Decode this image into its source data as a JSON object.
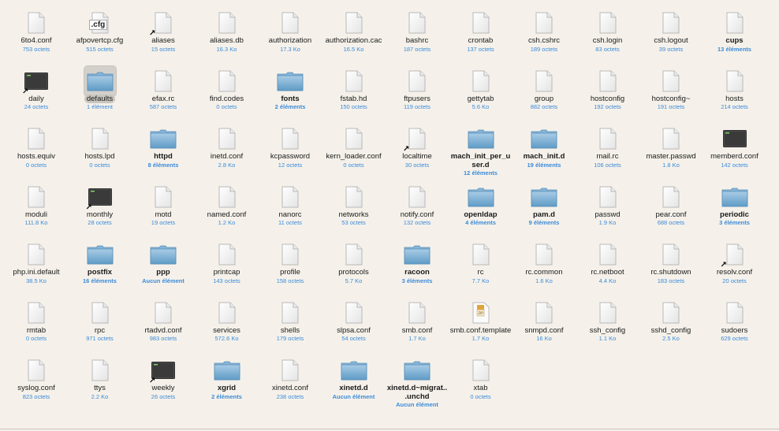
{
  "window": {
    "view": "icon-grid"
  },
  "colors": {
    "background": "#f5f1ea",
    "size_text": "#3c8bd8",
    "folder": "#6fa7cf"
  },
  "items": [
    {
      "name": "6to4.conf",
      "size": "753 octets",
      "type": "doc"
    },
    {
      "name": "afpovertcp.cfg",
      "size": "515 octets",
      "type": "cfg",
      "badge": ".cfg"
    },
    {
      "name": "aliases",
      "size": "15 octets",
      "type": "doc",
      "alias": true
    },
    {
      "name": "aliases.db",
      "size": "16.3 Ko",
      "type": "doc"
    },
    {
      "name": "authorization",
      "size": "17.3 Ko",
      "type": "doc"
    },
    {
      "name": "authorization.cac",
      "size": "16.5 Ko",
      "type": "doc"
    },
    {
      "name": "bashrc",
      "size": "187 octets",
      "type": "doc"
    },
    {
      "name": "crontab",
      "size": "137 octets",
      "type": "doc"
    },
    {
      "name": "csh.cshrc",
      "size": "189 octets",
      "type": "doc"
    },
    {
      "name": "csh.login",
      "size": "83 octets",
      "type": "doc"
    },
    {
      "name": "csh.logout",
      "size": "39 octets",
      "type": "doc"
    },
    {
      "name": "cups",
      "size": "13 éléments",
      "type": "doc",
      "bold": true
    },
    {
      "name": "daily",
      "size": "24 octets",
      "type": "terminal",
      "alias": true
    },
    {
      "name": "defaults",
      "size": "1 élément",
      "type": "folder",
      "selected": true
    },
    {
      "name": "efax.rc",
      "size": "587 octets",
      "type": "doc"
    },
    {
      "name": "find.codes",
      "size": "0 octets",
      "type": "doc"
    },
    {
      "name": "fonts",
      "size": "2 éléments",
      "type": "folder",
      "bold": true
    },
    {
      "name": "fstab.hd",
      "size": "150 octets",
      "type": "doc"
    },
    {
      "name": "ftpusers",
      "size": "119 octets",
      "type": "doc"
    },
    {
      "name": "gettytab",
      "size": "5.6 Ko",
      "type": "doc"
    },
    {
      "name": "group",
      "size": "882 octets",
      "type": "doc"
    },
    {
      "name": "hostconfig",
      "size": "192 octets",
      "type": "doc"
    },
    {
      "name": "hostconfig~",
      "size": "191 octets",
      "type": "doc"
    },
    {
      "name": "hosts",
      "size": "214 octets",
      "type": "doc"
    },
    {
      "name": "hosts.equiv",
      "size": "0 octets",
      "type": "doc"
    },
    {
      "name": "hosts.lpd",
      "size": "0 octets",
      "type": "doc"
    },
    {
      "name": "httpd",
      "size": "8 éléments",
      "type": "folder",
      "bold": true
    },
    {
      "name": "inetd.conf",
      "size": "2.8 Ko",
      "type": "doc"
    },
    {
      "name": "kcpassword",
      "size": "12 octets",
      "type": "doc"
    },
    {
      "name": "kern_loader.conf",
      "size": "0 octets",
      "type": "doc"
    },
    {
      "name": "localtime",
      "size": "30 octets",
      "type": "doc",
      "alias": true
    },
    {
      "name": "mach_init_per_user.d",
      "size": "12 éléments",
      "type": "folder",
      "bold": true
    },
    {
      "name": "mach_init.d",
      "size": "19 éléments",
      "type": "folder",
      "bold": true
    },
    {
      "name": "mail.rc",
      "size": "106 octets",
      "type": "doc"
    },
    {
      "name": "master.passwd",
      "size": "1.8 Ko",
      "type": "doc"
    },
    {
      "name": "memberd.conf",
      "size": "142 octets",
      "type": "terminal"
    },
    {
      "name": "moduli",
      "size": "111.8 Ko",
      "type": "doc"
    },
    {
      "name": "monthly",
      "size": "28 octets",
      "type": "terminal",
      "alias": true
    },
    {
      "name": "motd",
      "size": "19 octets",
      "type": "doc"
    },
    {
      "name": "named.conf",
      "size": "1.2 Ko",
      "type": "doc"
    },
    {
      "name": "nanorc",
      "size": "11 octets",
      "type": "doc"
    },
    {
      "name": "networks",
      "size": "53 octets",
      "type": "doc"
    },
    {
      "name": "notify.conf",
      "size": "132 octets",
      "type": "doc"
    },
    {
      "name": "openldap",
      "size": "4 éléments",
      "type": "folder",
      "bold": true
    },
    {
      "name": "pam.d",
      "size": "9 éléments",
      "type": "folder",
      "bold": true
    },
    {
      "name": "passwd",
      "size": "1.9 Ko",
      "type": "doc"
    },
    {
      "name": "pear.conf",
      "size": "688 octets",
      "type": "doc"
    },
    {
      "name": "periodic",
      "size": "3 éléments",
      "type": "folder",
      "bold": true
    },
    {
      "name": "php.ini.default",
      "size": "38.5 Ko",
      "type": "doc"
    },
    {
      "name": "postfix",
      "size": "16 éléments",
      "type": "folder",
      "bold": true
    },
    {
      "name": "ppp",
      "size": "Aucun élément",
      "type": "folder",
      "bold": true
    },
    {
      "name": "printcap",
      "size": "143 octets",
      "type": "doc"
    },
    {
      "name": "profile",
      "size": "158 octets",
      "type": "doc"
    },
    {
      "name": "protocols",
      "size": "5.7 Ko",
      "type": "doc"
    },
    {
      "name": "racoon",
      "size": "3 éléments",
      "type": "folder",
      "bold": true
    },
    {
      "name": "rc",
      "size": "7.7 Ko",
      "type": "doc"
    },
    {
      "name": "rc.common",
      "size": "1.6 Ko",
      "type": "doc"
    },
    {
      "name": "rc.netboot",
      "size": "4.4 Ko",
      "type": "doc"
    },
    {
      "name": "rc.shutdown",
      "size": "183 octets",
      "type": "doc"
    },
    {
      "name": "resolv.conf",
      "size": "20 octets",
      "type": "doc",
      "alias": true
    },
    {
      "name": "rmtab",
      "size": "0 octets",
      "type": "doc"
    },
    {
      "name": "rpc",
      "size": "971 octets",
      "type": "doc"
    },
    {
      "name": "rtadvd.conf",
      "size": "983 octets",
      "type": "doc"
    },
    {
      "name": "services",
      "size": "572.6 Ko",
      "type": "doc"
    },
    {
      "name": "shells",
      "size": "179 octets",
      "type": "doc"
    },
    {
      "name": "slpsa.conf",
      "size": "54 octets",
      "type": "doc"
    },
    {
      "name": "smb.conf",
      "size": "1.7 Ko",
      "type": "doc"
    },
    {
      "name": "smb.conf.template",
      "size": "1.7 Ko",
      "type": "zip"
    },
    {
      "name": "snmpd.conf",
      "size": "16 Ko",
      "type": "doc"
    },
    {
      "name": "ssh_config",
      "size": "1.1 Ko",
      "type": "doc"
    },
    {
      "name": "sshd_config",
      "size": "2.5 Ko",
      "type": "doc"
    },
    {
      "name": "sudoers",
      "size": "629 octets",
      "type": "doc"
    },
    {
      "name": "syslog.conf",
      "size": "823 octets",
      "type": "doc"
    },
    {
      "name": "ttys",
      "size": "2.2 Ko",
      "type": "doc"
    },
    {
      "name": "weekly",
      "size": "26 octets",
      "type": "terminal",
      "alias": true
    },
    {
      "name": "xgrid",
      "size": "2 éléments",
      "type": "folder",
      "bold": true
    },
    {
      "name": "xinetd.conf",
      "size": "238 octets",
      "type": "doc"
    },
    {
      "name": "xinetd.d",
      "size": "Aucun élément",
      "type": "folder",
      "bold": true
    },
    {
      "name": "xinetd.d~migrat...unchd",
      "size": "Aucun élément",
      "type": "folder",
      "bold": true
    },
    {
      "name": "xtab",
      "size": "0 octets",
      "type": "doc"
    }
  ]
}
